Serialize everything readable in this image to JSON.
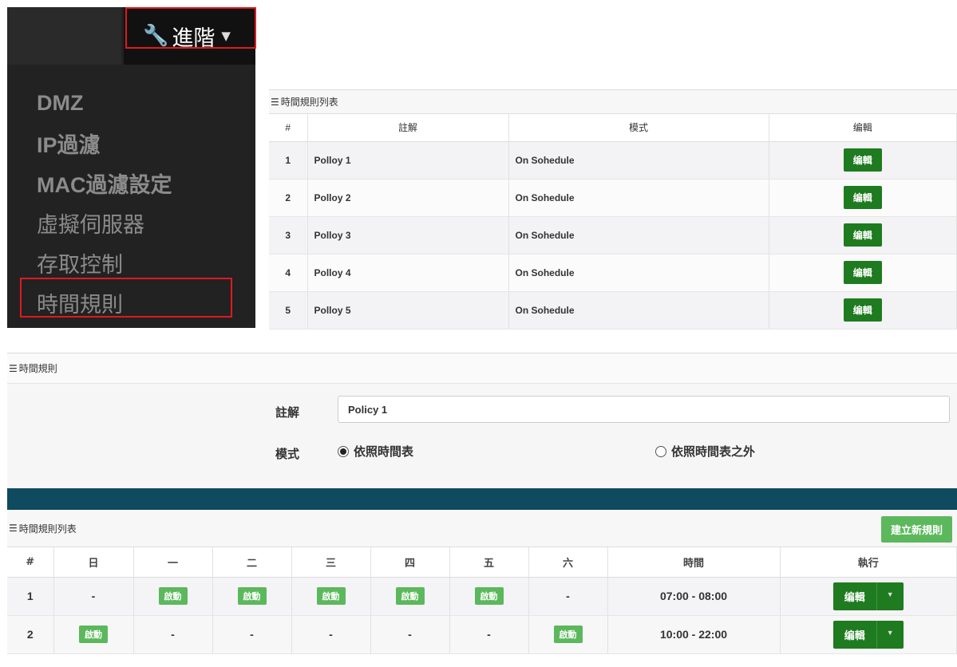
{
  "menu": {
    "toggle_label": "進階",
    "wrench_icon": "wrench-icon",
    "caret": "▼",
    "items": [
      {
        "label": "DMZ"
      },
      {
        "label": "IP過濾"
      },
      {
        "label": "MAC過濾設定"
      },
      {
        "label": "虛擬伺服器"
      },
      {
        "label": "存取控制"
      },
      {
        "label": "時間規則"
      }
    ]
  },
  "policy_list": {
    "title": "時間規則列表",
    "headers": [
      "#",
      "註解",
      "模式",
      "编輯"
    ],
    "rows": [
      {
        "num": "1",
        "note": "Polloy 1",
        "mode": "On Sohedule",
        "edit": "编輯"
      },
      {
        "num": "2",
        "note": "Polloy 2",
        "mode": "On Sohedule",
        "edit": "编輯"
      },
      {
        "num": "3",
        "note": "Polloy 3",
        "mode": "On Sohedule",
        "edit": "编輯"
      },
      {
        "num": "4",
        "note": "Polloy 4",
        "mode": "On Sohedule",
        "edit": "编輯"
      },
      {
        "num": "5",
        "note": "Polloy 5",
        "mode": "On Sohedule",
        "edit": "编輯"
      }
    ]
  },
  "rule_form": {
    "title": "時間規則",
    "note_label": "註解",
    "note_value": "Policy 1",
    "mode_label": "模式",
    "mode_option_1": "依照時間表",
    "mode_option_2": "依照時間表之外"
  },
  "schedule_list": {
    "title": "時間規則列表",
    "create_button": "建立新規則",
    "headers": [
      "#",
      "日",
      "一",
      "二",
      "三",
      "四",
      "五",
      "六",
      "時間",
      "執行"
    ],
    "rows": [
      {
        "num": "1",
        "sun": "-",
        "mon": "啟動",
        "tue": "啟動",
        "wed": "啟動",
        "thu": "啟動",
        "fri": "啟動",
        "sat": "-",
        "time": "07:00 - 08:00",
        "action": "编輯"
      },
      {
        "num": "2",
        "sun": "啟動",
        "mon": "-",
        "tue": "-",
        "wed": "-",
        "thu": "-",
        "fri": "-",
        "sat": "啟動",
        "time": "10:00 - 22:00",
        "action": "编輯"
      }
    ]
  },
  "colors": {
    "dark_green": "#1e7b1f",
    "light_green": "#5cb85c",
    "highlight_red": "#e0191e",
    "band_teal": "#0f4a5e"
  }
}
